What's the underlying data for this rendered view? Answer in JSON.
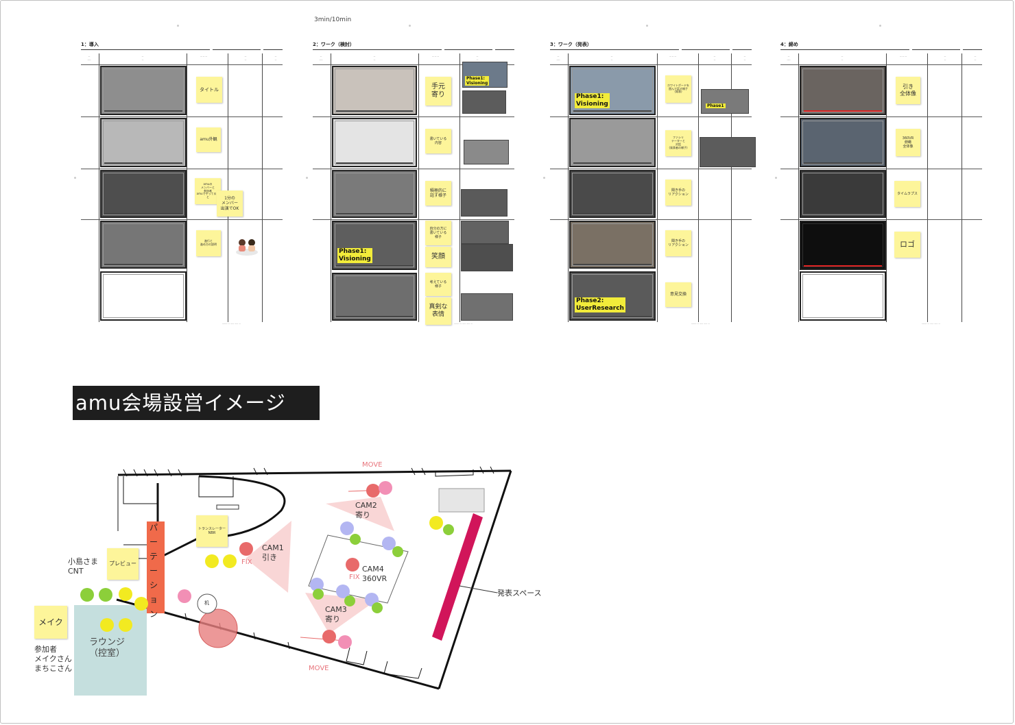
{
  "timing": "3min/10min",
  "boards": [
    {
      "title": "1：導入",
      "shots": [
        "",
        "",
        "",
        "",
        ""
      ],
      "stickies": [
        "タイトル",
        "amu外観",
        "amuの\nメンバーと\n参加者\namuでやってること",
        "進行と\n進め方の説明",
        "1分の\nメンバー\n出演でOK"
      ]
    },
    {
      "title": "2：ワーク（検討）",
      "shots": [
        "",
        "",
        "",
        "Phase1:\nVisioning",
        ""
      ],
      "stickies": [
        "手元\n寄り",
        "書いている\n内容",
        "積極的に\n話す様子",
        "自分の方に\n書いている\n様子",
        "笑顔",
        "考えている\n様子",
        "真剣な\n表情"
      ],
      "refs": [
        "Phase1:\nVisioning"
      ]
    },
    {
      "title": "3：ワーク（発表）",
      "shots": [
        "Phase1:\nVisioning",
        "",
        "",
        "",
        "Phase2:\nUserResearch"
      ],
      "stickies": [
        "ホワイトボードを\n囲んで話す様子\n(発表)",
        "ファシリ\nテーターと\n対話\n(発表者の様子)",
        "聞き手の\nリアクション",
        "聞き手の\nリアクション",
        "意見交換"
      ],
      "refs": [
        "Phase1"
      ]
    },
    {
      "title": "4：締め",
      "shots": [
        "",
        "",
        "",
        "",
        ""
      ],
      "stickies": [
        "引き\n全体像",
        "360VR\n俯瞰\n全体像",
        "タイムラプス",
        "ロゴ"
      ]
    }
  ],
  "heading": "amu会場設営イメージ",
  "floorplan": {
    "move_top": "MOVE",
    "move_bottom": "MOVE",
    "cam1": "CAM1\n引き",
    "cam2": "CAM2\n寄り",
    "cam3": "CAM3\n寄り",
    "cam4": "CAM4\n360VR",
    "fix1": "FIX",
    "fix2": "FIX",
    "partition": "パーテーション",
    "preview": "プレビュー",
    "translator": "トランスレーター\nNBR",
    "makeup": "メイク",
    "lounge": "ラウンジ\n（控室）",
    "kojima": "小島さま\nCNT",
    "participants": "参加者\nメイクさん\nまちこさん",
    "stage": "発表スペース",
    "desk": "机"
  },
  "colors": {
    "sticky": "#fdf59a",
    "camera": "#e86a6a",
    "accent_pink": "#f28fb5",
    "participant_purple": "#b3b6f2",
    "participant_green": "#8ccf3a",
    "staff_yellow": "#f2ea21",
    "partition": "#f06a4a",
    "lounge": "#c5dfde",
    "stage": "#d1155a"
  }
}
